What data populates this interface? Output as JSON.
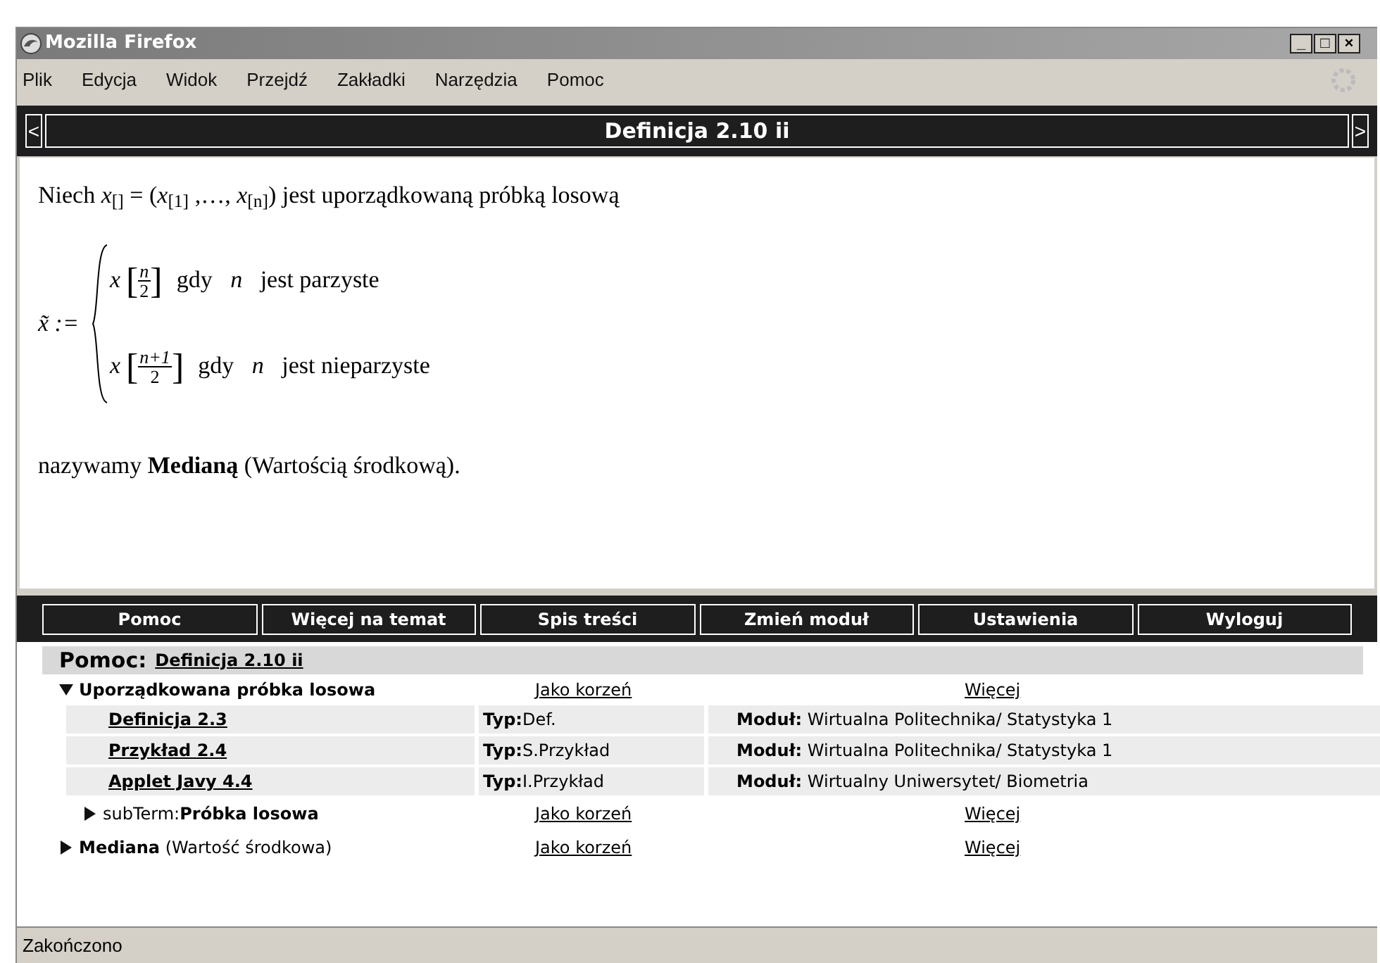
{
  "window": {
    "title": "Mozilla Firefox",
    "controls": [
      "_",
      "□",
      "×"
    ]
  },
  "menu": [
    {
      "label": "Plik"
    },
    {
      "label": "Edycja"
    },
    {
      "label": "Widok"
    },
    {
      "label": "Przejdź"
    },
    {
      "label": "Zakładki"
    },
    {
      "label": "Narzędzia"
    },
    {
      "label": "Pomoc"
    }
  ],
  "nav": {
    "prev": "<",
    "title": "Definicja 2.10 ii",
    "next": ">"
  },
  "content": {
    "intro": "Niech *x*$_{[]}$ = (*x*$_{[1]}$ ,…, *x*$_{[n]}$) jest uporządkowaną próbką losową",
    "lhs": "x̃ :=",
    "cases": [
      {
        "var": "x",
        "open": "[",
        "num": "n",
        "den": "2",
        "close": "]",
        "cond": "gdy",
        "n": "n",
        "text": "jest parzyste"
      },
      {
        "var": "x",
        "open": "[",
        "num": "n+1",
        "den": "2",
        "close": "]",
        "cond": "gdy",
        "n": "n",
        "text": "jest nieparzyste"
      }
    ],
    "closing": "nazywamy **Medianą** (Wartością środkową)."
  },
  "bottom_nav": [
    {
      "label": "Pomoc"
    },
    {
      "label": "Więcej na temat"
    },
    {
      "label": "Spis treści"
    },
    {
      "label": "Zmień moduł"
    },
    {
      "label": "Ustawienia"
    },
    {
      "label": "Wyloguj"
    }
  ],
  "help": {
    "title": "Pomoc:",
    "link": "Definicja 2.10 ii",
    "items": [
      {
        "kind": "term",
        "label": "Uporządkowana próbka losowa",
        "expanded": true,
        "root_link": "Jako korzeń",
        "more_link": "Więcej",
        "children": [
          {
            "kind": "resource",
            "name": "Definicja 2.3",
            "type_label": "Typ:",
            "type": "Def.",
            "module_label": "Moduł:",
            "module": "Wirtualna Politechnika/ Statystyka 1"
          },
          {
            "kind": "resource",
            "name": "Przykład 2.4",
            "type_label": "Typ:",
            "type": "S.Przykład",
            "module_label": "Moduł:",
            "module": "Wirtualna Politechnika/ Statystyka 1"
          },
          {
            "kind": "resource",
            "name": "Applet Javy 4.4",
            "type_label": "Typ:",
            "type": "I.Przykład",
            "module_label": "Moduł:",
            "module": "Wirtualny Uniwersytet/ Biometria"
          },
          {
            "kind": "subterm",
            "prefix": "subTerm:",
            "label": "Próbka losowa",
            "expanded": false,
            "root_link": "Jako korzeń",
            "more_link": "Więcej"
          }
        ]
      },
      {
        "kind": "term",
        "label": "Mediana",
        "note": "(Wartość środkowa)",
        "expanded": false,
        "root_link": "Jako korzeń",
        "more_link": "Więcej"
      }
    ]
  },
  "status_bar": "Zakończono"
}
